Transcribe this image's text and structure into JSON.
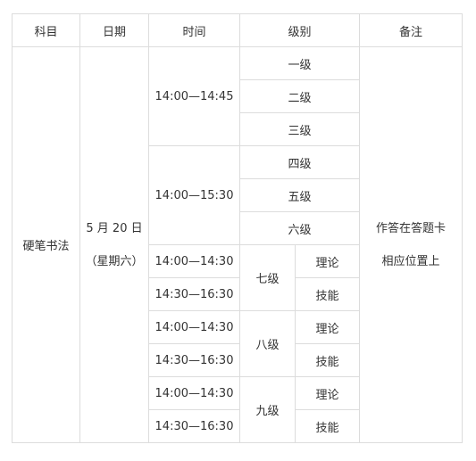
{
  "headers": {
    "subject": "科目",
    "date": "日期",
    "time": "时间",
    "level": "级别",
    "note": "备注"
  },
  "subject": "硬笔书法",
  "date": {
    "line1": "5 月 20 日",
    "line2": "（星期六）"
  },
  "note": {
    "line1": "作答在答题卡",
    "line2": "相应位置上"
  },
  "group1": {
    "time": "14:00—14:45",
    "levels": [
      "一级",
      "二级",
      "三级"
    ]
  },
  "group2": {
    "time": "14:00—15:30",
    "levels": [
      "四级",
      "五级",
      "六级"
    ]
  },
  "upper_levels": [
    {
      "level": "七级",
      "parts": [
        {
          "time": "14:00—14:30",
          "part": "理论"
        },
        {
          "time": "14:30—16:30",
          "part": "技能"
        }
      ]
    },
    {
      "level": "八级",
      "parts": [
        {
          "time": "14:00—14:30",
          "part": "理论"
        },
        {
          "time": "14:30—16:30",
          "part": "技能"
        }
      ]
    },
    {
      "level": "九级",
      "parts": [
        {
          "time": "14:00—14:30",
          "part": "理论"
        },
        {
          "time": "14:30—16:30",
          "part": "技能"
        }
      ]
    }
  ]
}
